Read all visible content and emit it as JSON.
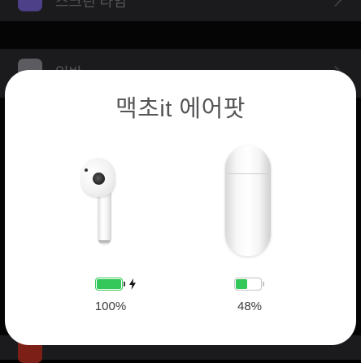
{
  "background": {
    "rows": [
      {
        "label": "스크린 타임",
        "icon": "hourglass-icon"
      },
      {
        "label": "일반",
        "icon": "gear-icon"
      }
    ]
  },
  "popup": {
    "device_name": "맥초it 에어팟",
    "earbud": {
      "icon": "airpod-earbud-icon",
      "battery_level": 1.0,
      "charging": true,
      "battery_text": "100%"
    },
    "case": {
      "icon": "airpods-case-icon",
      "battery_level": 0.48,
      "charging": false,
      "battery_text": "48%"
    },
    "colors": {
      "battery_green": "#34c759",
      "card_background": "#ffffff",
      "title_color": "#555558"
    }
  }
}
